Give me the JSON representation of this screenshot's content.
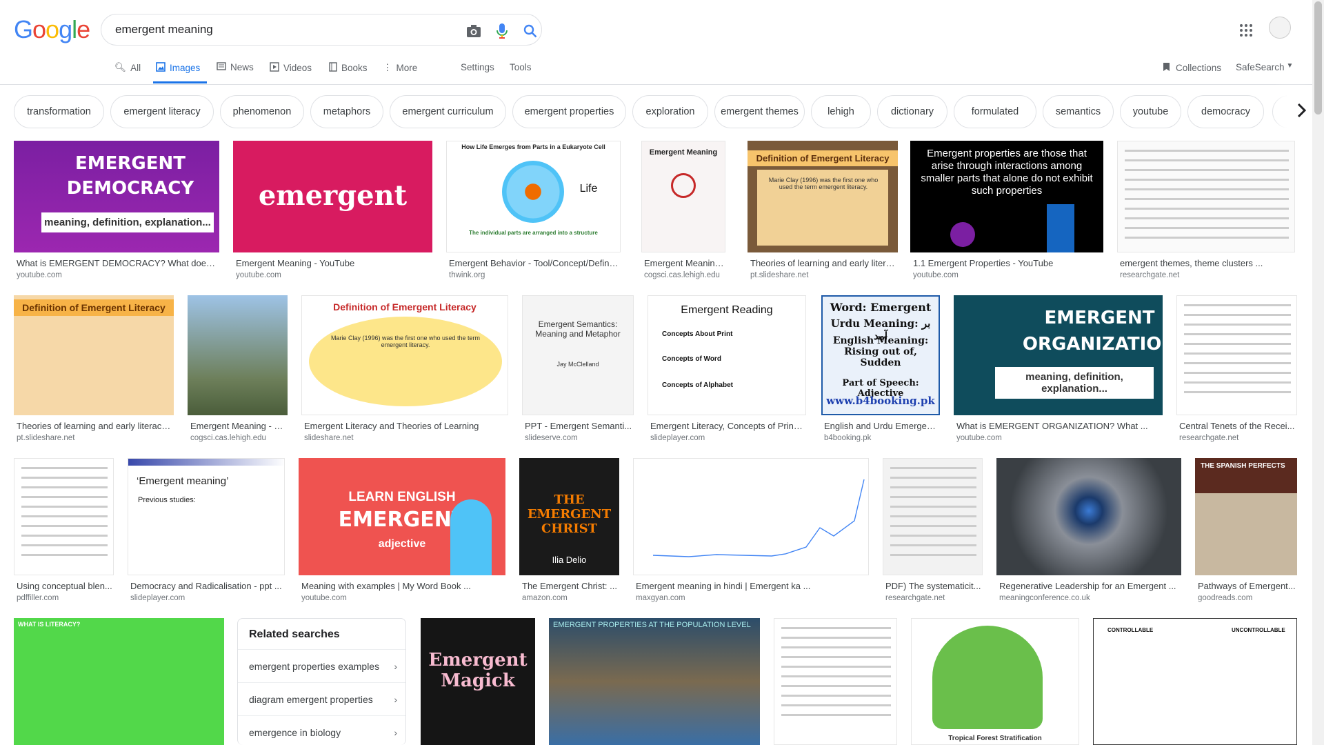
{
  "header": {
    "logo": {
      "G": "G",
      "o1": "o",
      "o2": "o",
      "g": "g",
      "l": "l",
      "e": "e"
    },
    "query": "emergent meaning"
  },
  "tabs": [
    {
      "label": "All",
      "icon": "search-icon"
    },
    {
      "label": "Images",
      "icon": "image-icon"
    },
    {
      "label": "News",
      "icon": "news-icon"
    },
    {
      "label": "Videos",
      "icon": "video-icon"
    },
    {
      "label": "Books",
      "icon": "book-icon"
    },
    {
      "label": "More",
      "icon": "more-icon"
    }
  ],
  "tools": {
    "settings": "Settings",
    "tools": "Tools",
    "collections": "Collections",
    "safesearch": "SafeSearch"
  },
  "chips": [
    "transformation",
    "emergent literacy",
    "phenomenon",
    "metaphors",
    "emergent curriculum",
    "emergent properties",
    "exploration",
    "emergent themes",
    "lehigh",
    "dictionary",
    "formulated",
    "semantics",
    "youtube",
    "democracy"
  ],
  "results": [
    {
      "caption": "What is EMERGENT DEMOCRACY? What does ...",
      "source": "youtube.com",
      "art": {
        "l1": "EMERGENT",
        "l2": "DEMOCRACY",
        "l3": "meaning, definition, explanation..."
      }
    },
    {
      "caption": "Emergent Meaning - YouTube",
      "source": "youtube.com",
      "art": {
        "l1": "emergent"
      }
    },
    {
      "caption": "Emergent Behavior - Tool/Concept/Definiti...",
      "source": "thwink.org",
      "art": {
        "l1": "How Life Emerges from Parts in a Eukaryote Cell",
        "l2": "Part",
        "l3": "Life",
        "l4": "The individual parts are arranged into a structure"
      }
    },
    {
      "caption": "Emergent Meaning Ne...",
      "source": "cogsci.cas.lehigh.edu",
      "art": {
        "l1": "Emergent Meaning"
      }
    },
    {
      "caption": "Theories of learning and early litera...",
      "source": "pt.slideshare.net",
      "art": {
        "l1": "Definition of Emergent Literacy",
        "l2": "Marie Clay (1996) was the first one who used the term emergent literacy."
      }
    },
    {
      "caption": "1.1 Emergent Properties - YouTube",
      "source": "youtube.com",
      "art": {
        "l1": "Emergent properties are those that arise through interactions among smaller parts that alone do not exhibit such properties"
      }
    },
    {
      "caption": "emergent themes, theme clusters ...",
      "source": "researchgate.net",
      "art": {}
    },
    {
      "caption": "Theories of learning and early literacy ...",
      "source": "pt.slideshare.net",
      "art": {
        "l1": "Definition of Emergent Literacy"
      }
    },
    {
      "caption": "Emergent Meaning - N...",
      "source": "cogsci.cas.lehigh.edu",
      "art": {}
    },
    {
      "caption": "Emergent Literacy and Theories of Learning",
      "source": "slideshare.net",
      "art": {
        "l1": "Definition of Emergent Literacy",
        "l2": "Marie Clay (1996) was the first one who used the term emergent literacy."
      }
    },
    {
      "caption": "PPT - Emergent Semanti...",
      "source": "slideserve.com",
      "art": {
        "l1": "Emergent Semantics: Meaning and Metaphor",
        "l2": "Jay McClelland"
      }
    },
    {
      "caption": "Emergent Literacy, Concepts of Print ...",
      "source": "slideplayer.com",
      "art": {
        "l1": "Emergent Reading",
        "l2": "Concepts About Print",
        "l3": "Concepts of Word",
        "l4": "Concepts of Alphabet"
      }
    },
    {
      "caption": "English and Urdu Emergent...",
      "source": "b4booking.pk",
      "art": {
        "l1": "Word: Emergent",
        "l2": "Urdu Meaning: بر آمد",
        "l3": "English Meaning: Rising out of, Sudden",
        "l4": "Part of Speech: Adjective",
        "l5": "www.b4booking.pk"
      }
    },
    {
      "caption": "What is EMERGENT ORGANIZATION? What ...",
      "source": "youtube.com",
      "art": {
        "l1": "EMERGENT",
        "l2": "ORGANIZATION",
        "l3": "meaning, definition, explanation..."
      }
    },
    {
      "caption": "Central Tenets of the Recei...",
      "source": "researchgate.net",
      "art": {}
    },
    {
      "caption": "Using conceptual blen...",
      "source": "pdffiller.com",
      "art": {}
    },
    {
      "caption": "Democracy and Radicalisation - ppt ...",
      "source": "slideplayer.com",
      "art": {
        "l1": "‘Emergent meaning’",
        "l2": "Previous studies:"
      }
    },
    {
      "caption": "Meaning with examples | My Word Book ...",
      "source": "youtube.com",
      "art": {
        "l1": "LEARN ENGLISH",
        "l2": "EMERGENT",
        "l3": "adjective"
      }
    },
    {
      "caption": "The Emergent Christ: ...",
      "source": "amazon.com",
      "art": {
        "l1": "THE EMERGENT CHRIST",
        "l2": "Ilia Delio"
      }
    },
    {
      "caption": "Emergent meaning in hindi | Emergent ka ...",
      "source": "maxgyan.com",
      "art": {}
    },
    {
      "caption": "PDF) The systematicit...",
      "source": "researchgate.net",
      "art": {}
    },
    {
      "caption": "Regenerative Leadership for an Emergent ...",
      "source": "meaningconference.co.uk",
      "art": {}
    },
    {
      "caption": "Pathways of Emergent...",
      "source": "goodreads.com",
      "art": {
        "l1": "THE SPANISH PERFECTS"
      }
    },
    {
      "caption": "",
      "source": "",
      "art": {
        "l1": "WHAT IS LITERACY?"
      }
    },
    {
      "caption": "",
      "source": "",
      "art": {
        "l1": "Emergent Magick"
      }
    },
    {
      "caption": "",
      "source": "",
      "art": {
        "l1": "EMERGENT PROPERTIES AT THE POPULATION LEVEL"
      }
    },
    {
      "caption": "",
      "source": "",
      "art": {}
    },
    {
      "caption": "",
      "source": "",
      "art": {
        "l1": "Tropical Forest Stratification"
      }
    },
    {
      "caption": "",
      "source": "",
      "art": {
        "l1": "CONTROLLABLE",
        "l2": "UNCONTROLLABLE"
      }
    }
  ],
  "related": {
    "title": "Related searches",
    "items": [
      "emergent properties examples",
      "diagram emergent properties",
      "emergence in biology"
    ]
  },
  "colors": {
    "accent": "#1a73e8",
    "brand_blue": "#4285f4",
    "brand_red": "#ea4335",
    "brand_yellow": "#fbbc05",
    "brand_green": "#34a853"
  }
}
